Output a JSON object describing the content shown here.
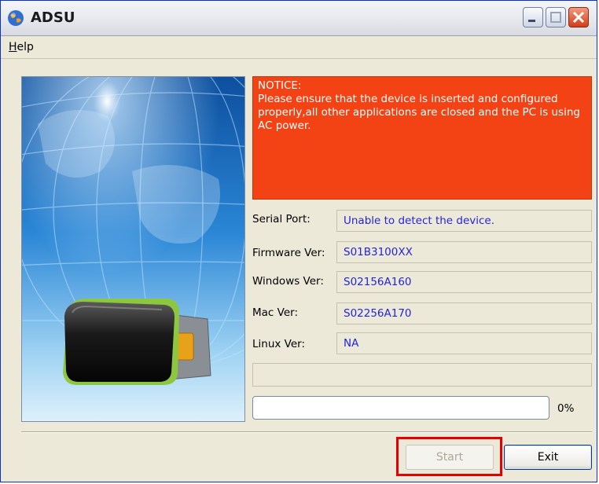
{
  "window": {
    "title": "ADSU",
    "app_icon": "globe-icon",
    "controls": [
      "minimize-icon",
      "maximize-icon",
      "close-icon"
    ]
  },
  "menu": {
    "help": "Help"
  },
  "notice": {
    "heading": "NOTICE:",
    "body": "Please ensure that the device is inserted and configured properly,all other applications are closed and the PC is using AC power."
  },
  "fields": {
    "serial_port": {
      "label": "Serial Port:",
      "value": "Unable to detect the device."
    },
    "firmware": {
      "label": "Firmware Ver:",
      "value": "S01B3100XX"
    },
    "windows": {
      "label": "Windows Ver:",
      "value": "S02156A160"
    },
    "mac": {
      "label": "Mac Ver:",
      "value": "S02256A170"
    },
    "linux": {
      "label": "Linux Ver:",
      "value": "NA"
    }
  },
  "status_text": "",
  "progress": {
    "value": 0,
    "label": "0%"
  },
  "buttons": {
    "start": "Start",
    "exit": "Exit"
  },
  "colors": {
    "notice_bg": "#f34314",
    "field_text": "#2424d8",
    "highlight": "#e40000"
  }
}
